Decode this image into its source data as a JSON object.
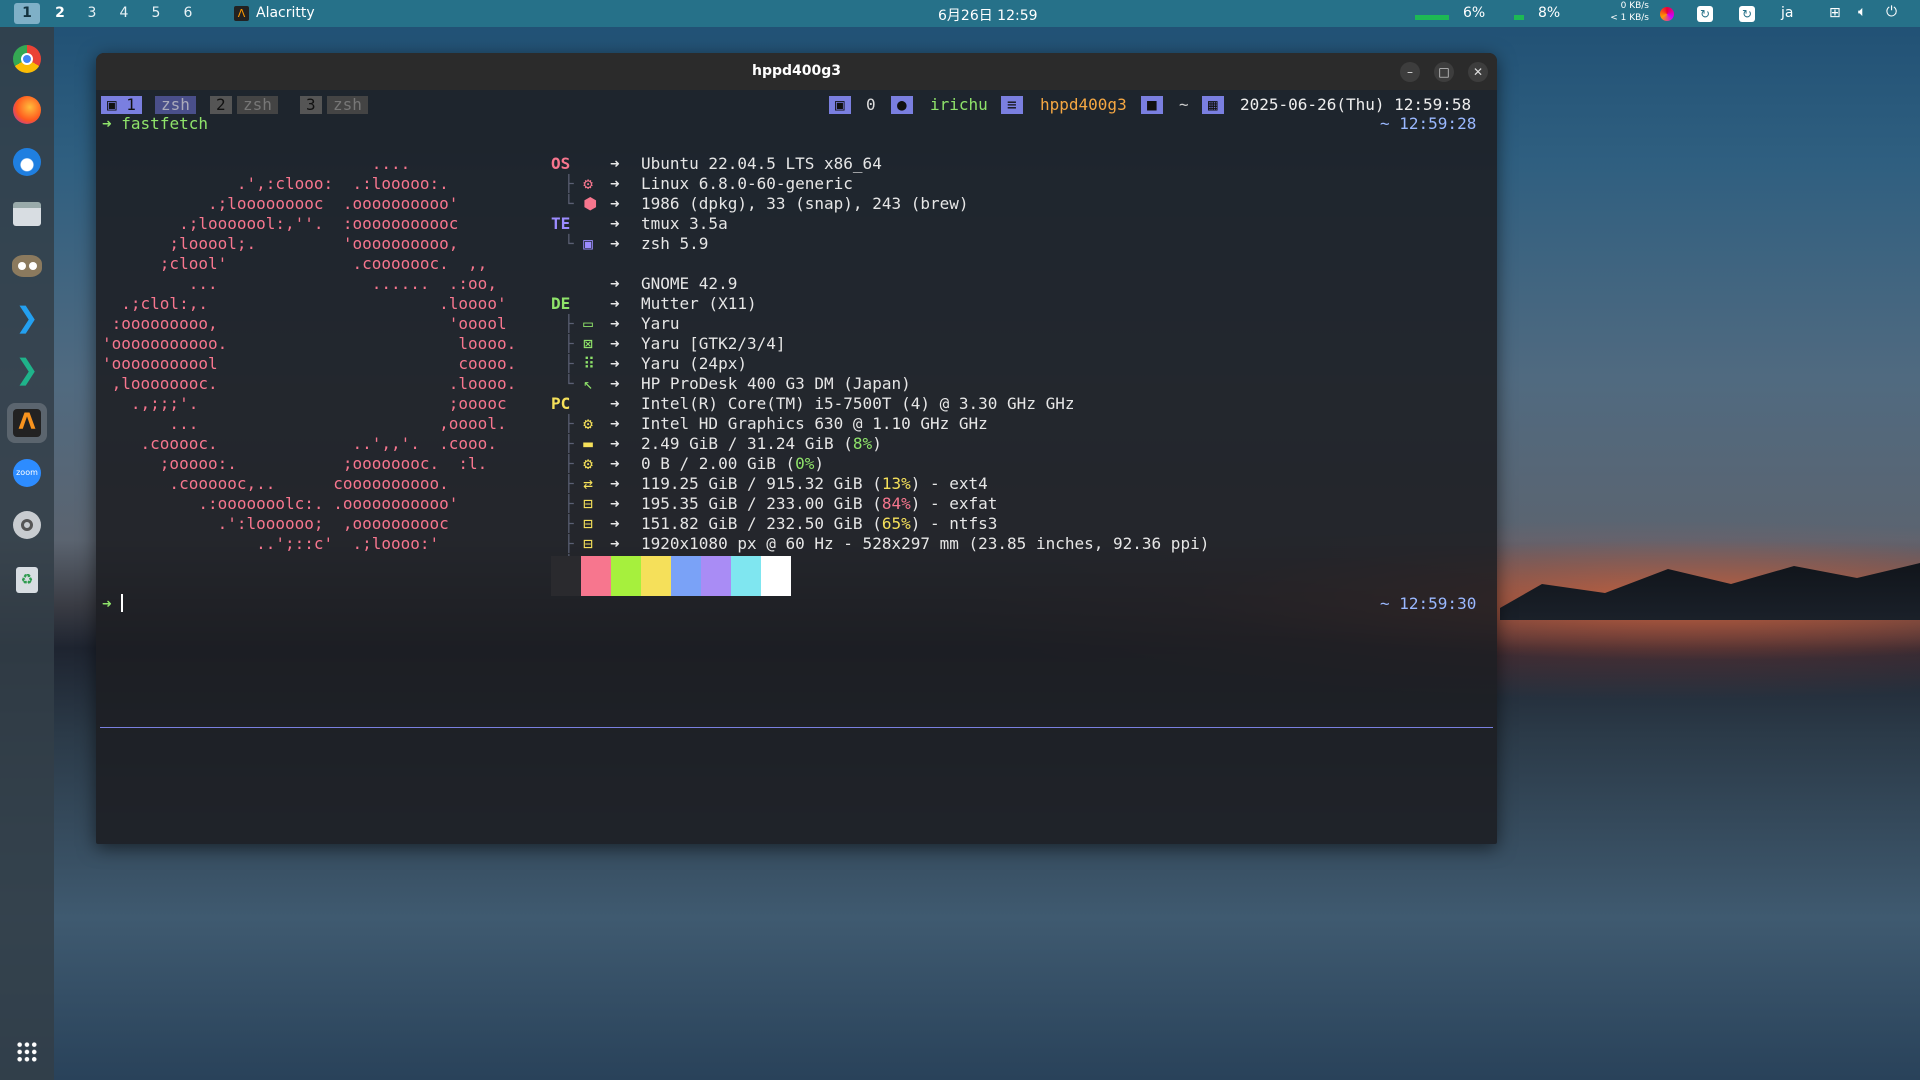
{
  "topbar": {
    "workspaces": [
      "1",
      "2",
      "3",
      "4",
      "5",
      "6"
    ],
    "active_app": "Alacritty",
    "datetime": "6月26日 12:59",
    "cpu": "6%",
    "mem": "8%",
    "net_down": "0 KB/s",
    "net_up": "< 1 KB/s",
    "lang": "ja"
  },
  "window": {
    "title": "hppd400g3"
  },
  "tmux": {
    "tabs": [
      {
        "num": "1",
        "name": "zsh"
      },
      {
        "num": "2",
        "name": "zsh"
      },
      {
        "num": "3",
        "name": "zsh"
      }
    ],
    "status_zero": "0",
    "user": "irichu",
    "host": "hppd400g3",
    "dir": "~",
    "datetime": "2025-06-26(Thu) 12:59:58"
  },
  "prompt": {
    "arrow": "➜",
    "command": "fastfetch",
    "time1": "~ 12:59:28",
    "time2": "~ 12:59:30"
  },
  "ascii": [
    "                            ....",
    "              .',:clooo:  .:looooo:.",
    "           .;looooooooc  .oooooooooo'",
    "        .;looooool:,''.  :ooooooooooc",
    "       ;looool;.         'oooooooooo,",
    "      ;clool'             .cooooooc.  ,,",
    "         ...                ......  .:oo,",
    "  .;clol:,.                        .loooo'",
    " :ooooooooo,                        'ooool",
    "'ooooooooooo.                        loooo.",
    "'ooooooooool                         coooo.",
    " ,loooooooc.                        .loooo.",
    "   .,;;;'.                          ;ooooc",
    "       ...                         ,ooool.",
    "    .cooooc.              ..',,'.  .cooo.",
    "      ;ooooo:.           ;oooooooc.  :l.",
    "       .coooooc,..      coooooooooo.",
    "          .:ooooooolc:. .ooooooooooo'",
    "            .':loooooo;  ,oooooooooc",
    "                ..';::c'  .;loooo:'"
  ],
  "info": {
    "os_label": "OS",
    "te_label": "TE",
    "de_label": "DE",
    "pc_label": "PC",
    "arrow": "➜",
    "os": "Ubuntu 22.04.5 LTS x86_64",
    "kernel": "Linux 6.8.0-60-generic",
    "packages": "1986 (dpkg), 33 (snap), 243 (brew)",
    "terminal": "tmux 3.5a",
    "shell": "zsh 5.9",
    "de": "GNOME 42.9",
    "wm": "Mutter (X11)",
    "wm_theme": "Yaru",
    "theme": "Yaru [GTK2/3/4]",
    "cursor": "Yaru (24px)",
    "host": "HP ProDesk 400 G3 DM (Japan)",
    "cpu": "Intel(R) Core(TM) i5-7500T (4) @ 3.30 GHz GHz",
    "gpu": "Intel HD Graphics 630 @ 1.10 GHz GHz",
    "mem_prefix": "2.49 GiB / 31.24 GiB (",
    "mem_pct": "8%",
    "mem_suffix": ")",
    "swap_prefix": "0 B / 2.00 GiB (",
    "swap_pct": "0%",
    "swap_suffix": ")",
    "disk1_prefix": "119.25 GiB / 915.32 GiB (",
    "disk1_pct": "13%",
    "disk1_suffix": ") - ext4",
    "disk2_prefix": "195.35 GiB / 233.00 GiB (",
    "disk2_pct": "84%",
    "disk2_suffix": ") - exfat",
    "disk3_prefix": "151.82 GiB / 232.50 GiB (",
    "disk3_pct": "65%",
    "disk3_suffix": ") - ntfs3",
    "display": "1920x1080 px @ 60 Hz - 528x297 mm (23.85 inches, 92.36 ppi)"
  },
  "palette": [
    "#2a2a2e",
    "#f7768e",
    "#a6f03d",
    "#f5e05a",
    "#7aa2f7",
    "#a98cf5",
    "#7fe6f0",
    "#ffffff"
  ],
  "colors": {
    "accent": "#267189",
    "ascii": "#f7768e",
    "label_os": "#f7768e",
    "label_te": "#9c8cff",
    "label_de": "#8fe36a",
    "label_pc": "#f5e05a"
  }
}
